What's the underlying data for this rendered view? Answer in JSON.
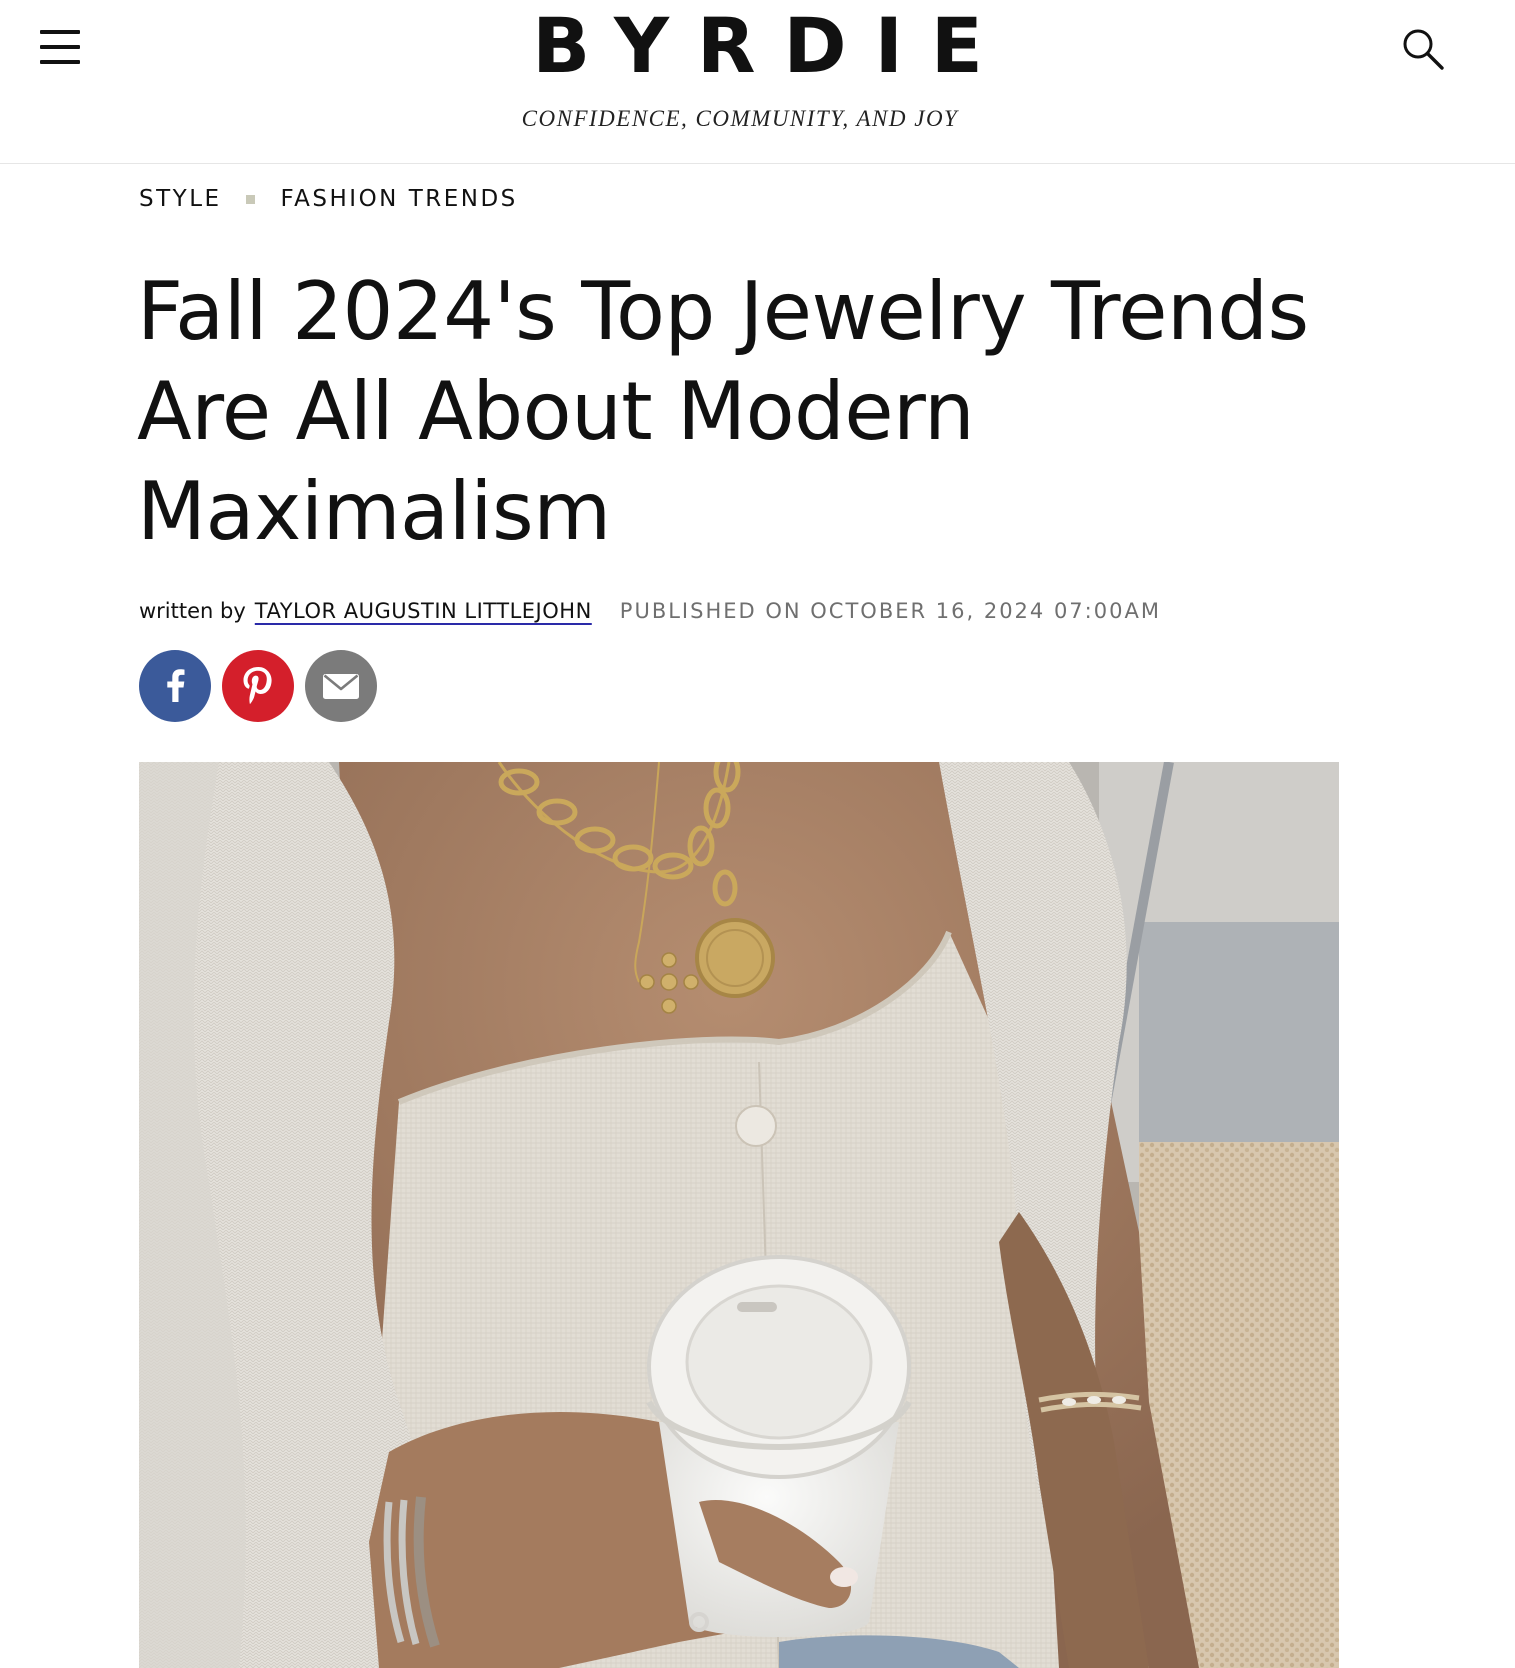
{
  "header": {
    "logo": "BYRDIE",
    "tagline": "CONFIDENCE, COMMUNITY, AND JOY",
    "menu_icon": "hamburger-menu-icon",
    "search_icon": "search-icon"
  },
  "breadcrumb": {
    "items": [
      {
        "label": "STYLE"
      },
      {
        "label": "FASHION TRENDS"
      }
    ]
  },
  "article": {
    "title": "Fall 2024's Top Jewelry Trends Are All About Modern Maximalism",
    "byline_prefix": "written by",
    "author": "TAYLOR AUGUSTIN LITTLEJOHN",
    "published": "PUBLISHED ON OCTOBER 16, 2024 07:00AM"
  },
  "share": {
    "buttons": [
      {
        "icon": "facebook-icon",
        "color": "#3b5a9a"
      },
      {
        "icon": "pinterest-icon",
        "color": "#d41f2b"
      },
      {
        "icon": "email-icon",
        "color": "#7b7b7b"
      }
    ]
  },
  "hero_image": {
    "icon": "hero-photo"
  },
  "colors": {
    "text": "#111111",
    "muted": "#6f6f6f",
    "author_underline": "#2a2aa8",
    "breadcrumb_separator": "#c9c9b8"
  }
}
